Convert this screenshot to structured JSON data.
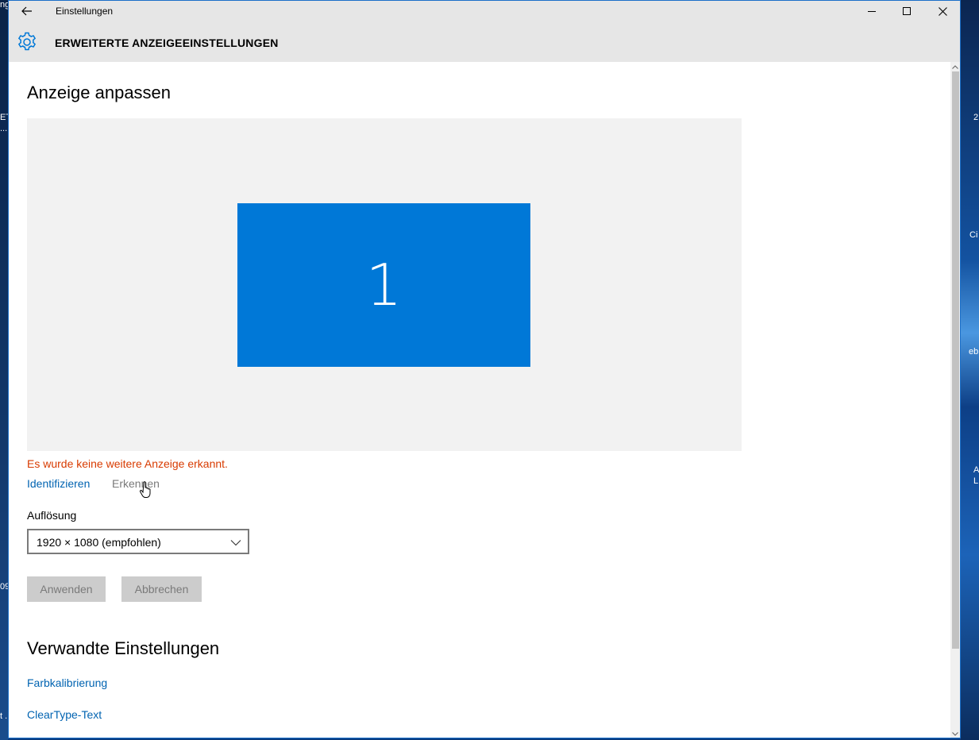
{
  "titlebar": {
    "title": "Einstellungen"
  },
  "header": {
    "title": "ERWEITERTE ANZEIGEEINSTELLUNGEN"
  },
  "main": {
    "heading": "Anzeige anpassen",
    "monitor_number": "1",
    "warning": "Es wurde keine weitere Anzeige erkannt.",
    "identify_link": "Identifizieren",
    "detect_link": "Erkennen",
    "resolution_label": "Auflösung",
    "resolution_value": "1920 × 1080 (empfohlen)",
    "apply_button": "Anwenden",
    "cancel_button": "Abbrechen"
  },
  "related": {
    "heading": "Verwandte Einstellungen",
    "links": [
      "Farbkalibrierung",
      "ClearType-Text"
    ]
  },
  "desktop": {
    "left_fragments": [
      "ng",
      "ET",
      "...",
      "09",
      "t ."
    ],
    "right_fragments": [
      "2",
      "Ci",
      "eb",
      "A",
      "L"
    ]
  },
  "colors": {
    "accent": "#0078d7",
    "link": "#0063b1",
    "warning": "#d83b01",
    "chrome": "#e6e6e6"
  }
}
